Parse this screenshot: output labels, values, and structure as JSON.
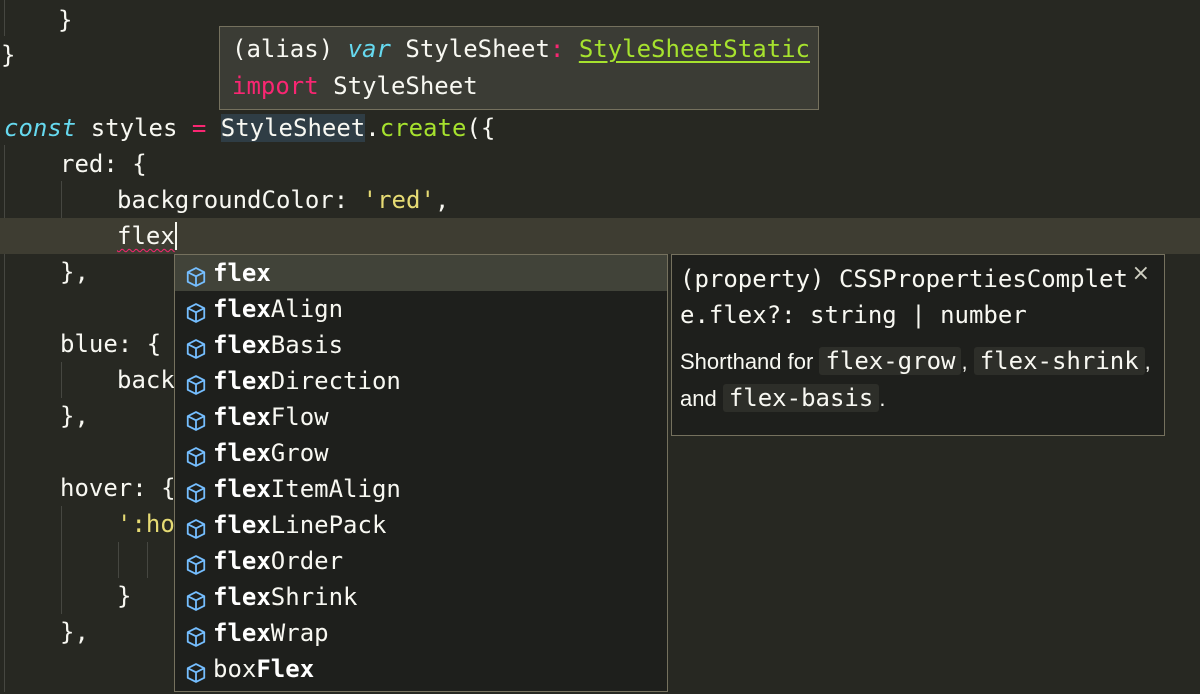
{
  "code": {
    "l0": "}",
    "l1": "}",
    "l3_kw": "const",
    "l3_var": " styles ",
    "l3_eq": "=",
    "l3_cls": "StyleSheet",
    "l3_dot": ".",
    "l3_fn": "create",
    "l3_tail": "({",
    "l4": "red: {",
    "l5_key": "backgroundColor: ",
    "l5_str": "'red'",
    "l5_tail": ",",
    "l6_typed": "flex",
    "l7": "},",
    "l9": "blue: {",
    "l10": "back",
    "l11": "},",
    "l13": "hover: {",
    "l14": "':ho",
    "l16": "}",
    "l17": "},"
  },
  "hover": {
    "paren": "(alias) ",
    "kw": "var",
    "name": " StyleSheet",
    "colon": ": ",
    "type": "StyleSheetStatic",
    "import_kw": "import",
    "import_name": " StyleSheet"
  },
  "suggestions": [
    {
      "match": "flex",
      "rest": "",
      "prefix": ""
    },
    {
      "match": "flex",
      "rest": "Align",
      "prefix": ""
    },
    {
      "match": "flex",
      "rest": "Basis",
      "prefix": ""
    },
    {
      "match": "flex",
      "rest": "Direction",
      "prefix": ""
    },
    {
      "match": "flex",
      "rest": "Flow",
      "prefix": ""
    },
    {
      "match": "flex",
      "rest": "Grow",
      "prefix": ""
    },
    {
      "match": "flex",
      "rest": "ItemAlign",
      "prefix": ""
    },
    {
      "match": "flex",
      "rest": "LinePack",
      "prefix": ""
    },
    {
      "match": "flex",
      "rest": "Order",
      "prefix": ""
    },
    {
      "match": "flex",
      "rest": "Shrink",
      "prefix": ""
    },
    {
      "match": "flex",
      "rest": "Wrap",
      "prefix": ""
    },
    {
      "match": "Flex",
      "rest": "",
      "prefix": "box"
    }
  ],
  "details": {
    "signature": "(property) CSSPropertiesComplete.flex?: string | number",
    "close": "×",
    "doc_intro": "Shorthand for ",
    "code1": "flex-grow",
    "sep1": ", ",
    "code2": "flex-shrink",
    "sep2": ", and ",
    "code3": "flex-basis",
    "end": "."
  },
  "colors": {
    "background": "#272822",
    "keyword": "#66d9ef",
    "string": "#e6db74",
    "function": "#a6e22e",
    "operator": "#f92672",
    "icon": "#75beff"
  },
  "icons": {
    "suggestion": "cube-icon",
    "close": "close-icon"
  }
}
